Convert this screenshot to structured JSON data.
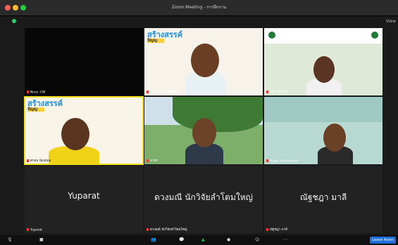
{
  "window": {
    "title": "Zoom Meeting - การฝึกงาน"
  },
  "top_right": {
    "view_label": "View"
  },
  "tiles": [
    {
      "name": "Nirut -CM",
      "big_name": ""
    },
    {
      "name": "ละบาธงะ O. เหรียญ",
      "big_name": ""
    },
    {
      "name": "ยติพร คำแดง",
      "big_name": ""
    },
    {
      "name": "ศาคม น้องหมอ",
      "big_name": ""
    },
    {
      "name": "มาคร",
      "big_name": ""
    },
    {
      "name": "Tupta Chumnaden",
      "big_name": ""
    },
    {
      "name": "Yuparat",
      "big_name": "Yuparat"
    },
    {
      "name": "ดวงมณี นักวิจัยลำโตมใหญ่",
      "big_name": "ดวงมณี นักวิจัยลำโตมใหญ่"
    },
    {
      "name": "ณัฐชฎา มาลี",
      "big_name": "ณัฐชฎา มาลี"
    }
  ],
  "logo": {
    "text": "สร้างสรรค์",
    "sub": "ปัญญ"
  },
  "toolbar": {
    "leave_label": "Leave Room"
  }
}
